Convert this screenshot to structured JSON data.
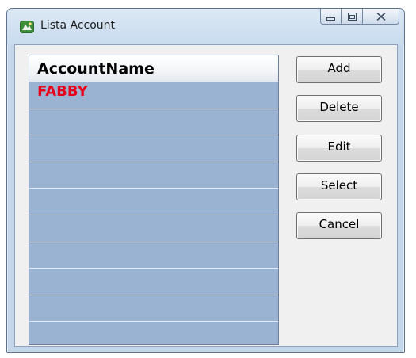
{
  "window": {
    "title": "Lista Account",
    "icon": "app-icon",
    "caption_buttons": [
      "minimize-icon",
      "maximize-icon",
      "close-icon"
    ]
  },
  "grid": {
    "column_header": "AccountName",
    "rows": [
      "FABBY",
      "",
      "",
      "",
      "",
      "",
      "",
      "",
      "",
      ""
    ],
    "row_text_color": "#e8001a",
    "background_color": "#9bb3d3"
  },
  "buttons": {
    "add": "Add",
    "delete": "Delete",
    "edit": "Edit",
    "select": "Select",
    "cancel": "Cancel"
  }
}
